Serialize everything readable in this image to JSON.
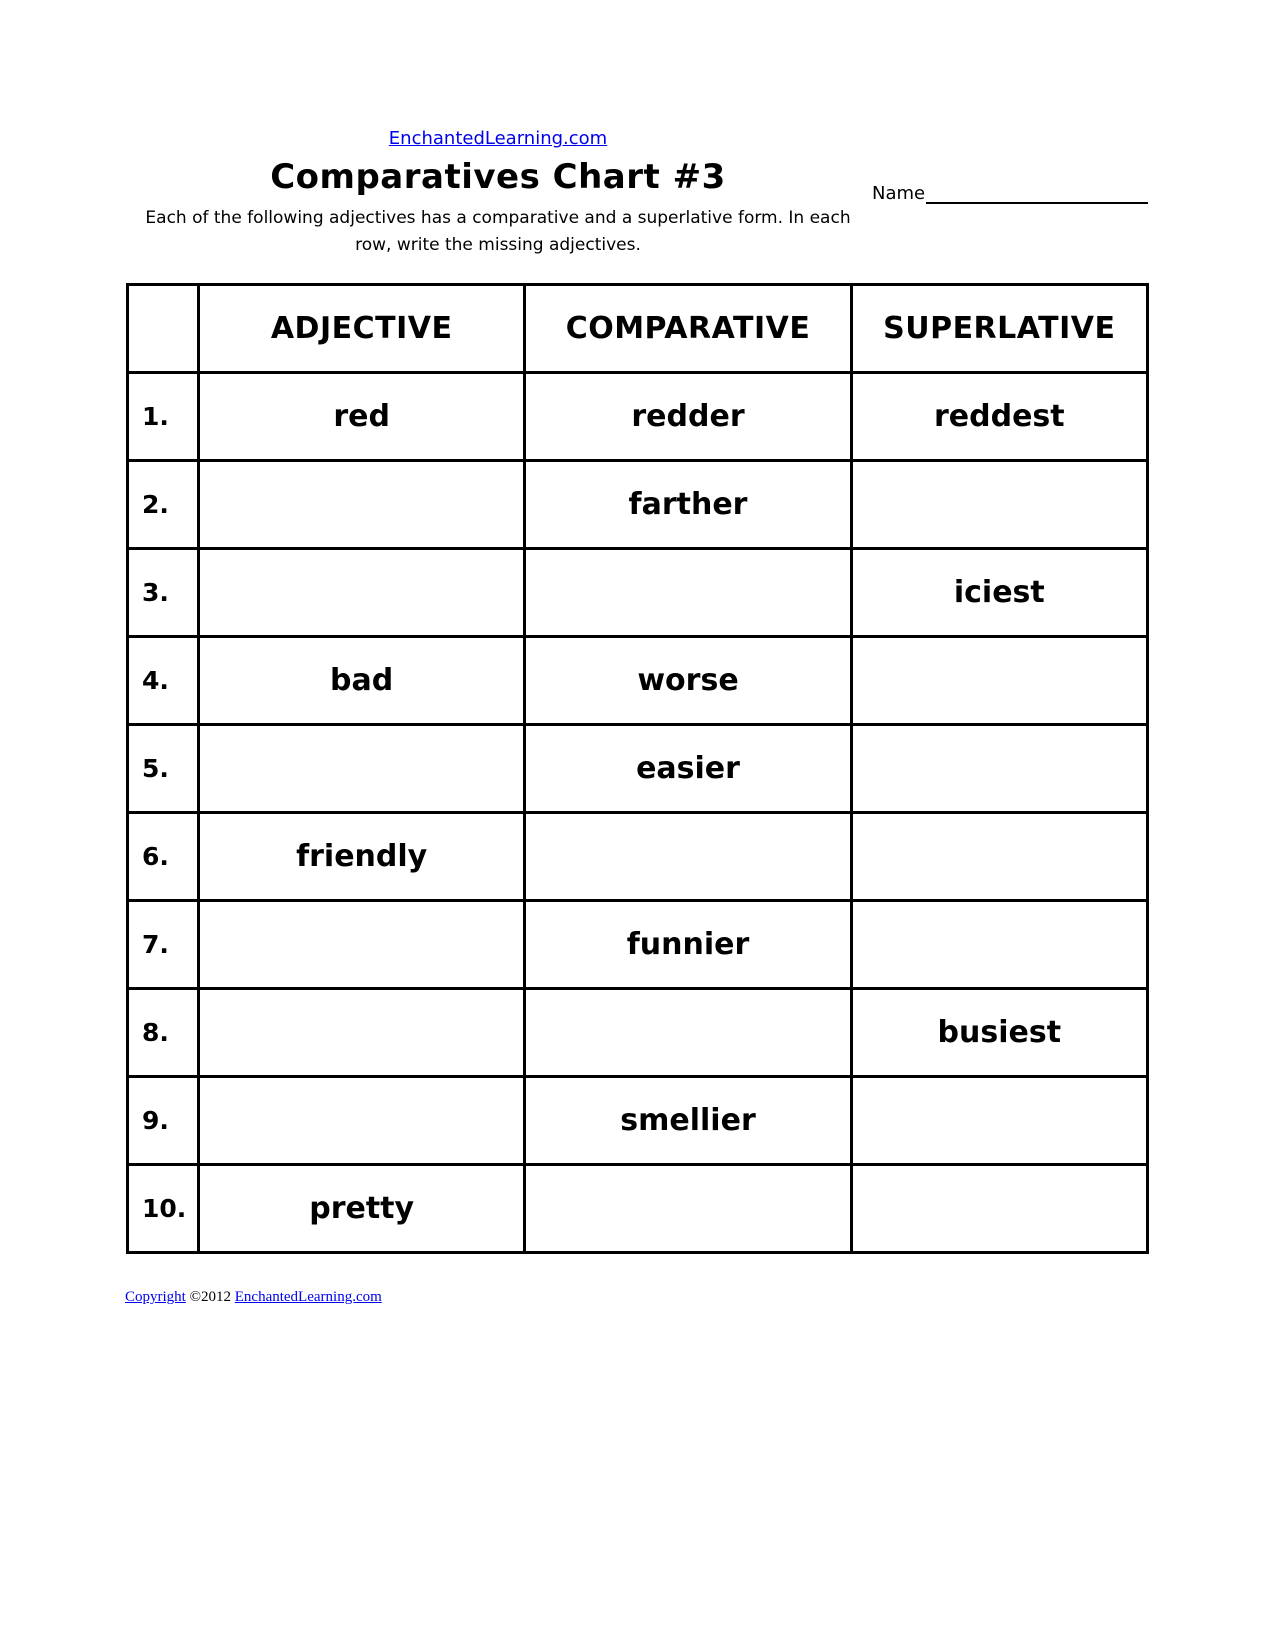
{
  "header": {
    "site_link": "EnchantedLearning.com",
    "title": "Comparatives Chart #3",
    "instructions": "Each of the following adjectives has a comparative and a superlative form. In each row, write the missing adjectives.",
    "name_label": "Name"
  },
  "table": {
    "columns": [
      "",
      "ADJECTIVE",
      "COMPARATIVE",
      "SUPERLATIVE"
    ],
    "rows": [
      {
        "num": "1.",
        "adjective": "red",
        "comparative": "redder",
        "superlative": "reddest"
      },
      {
        "num": "2.",
        "adjective": "",
        "comparative": "farther",
        "superlative": ""
      },
      {
        "num": "3.",
        "adjective": "",
        "comparative": "",
        "superlative": "iciest"
      },
      {
        "num": "4.",
        "adjective": "bad",
        "comparative": "worse",
        "superlative": ""
      },
      {
        "num": "5.",
        "adjective": "",
        "comparative": "easier",
        "superlative": ""
      },
      {
        "num": "6.",
        "adjective": "friendly",
        "comparative": "",
        "superlative": ""
      },
      {
        "num": "7.",
        "adjective": "",
        "comparative": "funnier",
        "superlative": ""
      },
      {
        "num": "8.",
        "adjective": "",
        "comparative": "",
        "superlative": "busiest"
      },
      {
        "num": "9.",
        "adjective": "",
        "comparative": "smellier",
        "superlative": ""
      },
      {
        "num": "10.",
        "adjective": "pretty",
        "comparative": "",
        "superlative": ""
      }
    ]
  },
  "footer": {
    "copyright_link": "Copyright",
    "year_text": " ©2012 ",
    "site_link": "EnchantedLearning.com"
  },
  "colors": {
    "link": "#0000ee",
    "text": "#000000"
  }
}
